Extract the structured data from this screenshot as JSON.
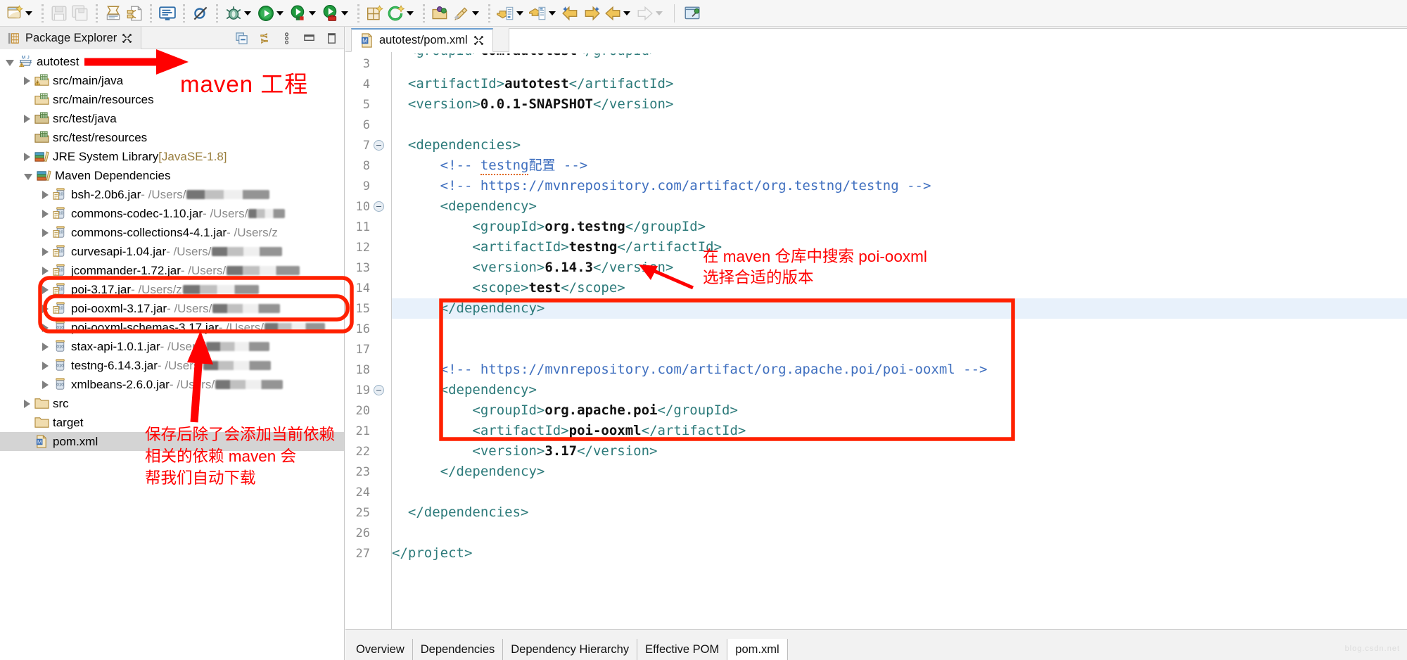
{
  "toolbar": {
    "items": [
      {
        "name": "new-wizard-icon",
        "caret": true
      },
      {
        "name": "save-icon",
        "caret": false
      },
      {
        "name": "save-all-icon",
        "caret": false
      },
      {
        "name": "print-icon",
        "caret": false
      },
      {
        "name": "refresh-link-icon",
        "caret": false
      },
      {
        "name": "open-console-icon",
        "caret": false
      },
      {
        "name": "skip-breakpoints-icon",
        "caret": false
      },
      {
        "name": "debug-icon",
        "caret": true
      },
      {
        "name": "run-icon",
        "caret": true
      },
      {
        "name": "coverage-icon",
        "caret": true
      },
      {
        "name": "external-tools-icon",
        "caret": true
      },
      {
        "name": "new-java-project-icon",
        "caret": false
      },
      {
        "name": "new-package-icon",
        "caret": true
      },
      {
        "name": "open-type-icon",
        "caret": false
      },
      {
        "name": "new-annotation-icon",
        "caret": true
      },
      {
        "name": "previous-annotation-icon",
        "caret": true
      },
      {
        "name": "next-annotation-icon",
        "caret": true
      },
      {
        "name": "last-edit-location-icon",
        "caret": false
      },
      {
        "name": "next-edit-location-icon",
        "caret": false
      },
      {
        "name": "back-icon",
        "caret": true
      },
      {
        "name": "forward-icon",
        "caret": true,
        "dim": true
      },
      {
        "name": "pin-editor-icon",
        "caret": false
      }
    ]
  },
  "package_explorer": {
    "tab_label": "Package Explorer",
    "view_tools": [
      "collapse-all-icon",
      "link-with-editor-icon",
      "view-menu-icon",
      "minimize-icon",
      "maximize-icon"
    ],
    "tree": [
      {
        "indent": 0,
        "arrow": "down",
        "icon": "maven-project-icon",
        "label": "autotest",
        "suffix": "",
        "name": "tree-item-autotest"
      },
      {
        "indent": 1,
        "arrow": "right",
        "icon": "source-folder-warning-icon",
        "label": "src/main/java",
        "suffix": "",
        "name": "tree-item-src-main-java"
      },
      {
        "indent": 1,
        "arrow": "none",
        "icon": "source-folder-icon",
        "label": "src/main/resources",
        "suffix": "",
        "name": "tree-item-src-main-resources"
      },
      {
        "indent": 1,
        "arrow": "right",
        "icon": "source-folder-green-icon",
        "label": "src/test/java",
        "suffix": "",
        "name": "tree-item-src-test-java"
      },
      {
        "indent": 1,
        "arrow": "none",
        "icon": "source-folder-green-icon",
        "label": "src/test/resources",
        "suffix": "",
        "name": "tree-item-src-test-resources"
      },
      {
        "indent": 1,
        "arrow": "right",
        "icon": "library-icon",
        "label": "JRE System Library",
        "suffix": " [JavaSE-1.8]",
        "suffix_class": "jre",
        "name": "tree-item-jre-system-library"
      },
      {
        "indent": 1,
        "arrow": "down",
        "icon": "library-icon",
        "label": "Maven Dependencies",
        "suffix": "",
        "name": "tree-item-maven-dependencies"
      },
      {
        "indent": 2,
        "arrow": "right",
        "icon": "jar-icon",
        "label": "bsh-2.0b6.jar",
        "suffix": " - /Users/",
        "blur": 118,
        "name": "tree-item-jar-bsh"
      },
      {
        "indent": 2,
        "arrow": "right",
        "icon": "jar-icon",
        "label": "commons-codec-1.10.jar",
        "suffix": " - /Users/",
        "blur": 52,
        "name": "tree-item-jar-commons-codec"
      },
      {
        "indent": 2,
        "arrow": "right",
        "icon": "jar-icon",
        "label": "commons-collections4-4.1.jar",
        "suffix": " - /Users/z",
        "blur": 0,
        "name": "tree-item-jar-commons-collections4"
      },
      {
        "indent": 2,
        "arrow": "right",
        "icon": "jar-icon",
        "label": "curvesapi-1.04.jar",
        "suffix": " - /Users/",
        "blur": 100,
        "name": "tree-item-jar-curvesapi"
      },
      {
        "indent": 2,
        "arrow": "right",
        "icon": "jar-icon",
        "label": "jcommander-1.72.jar",
        "suffix": " - /Users/",
        "blur": 104,
        "name": "tree-item-jar-jcommander"
      },
      {
        "indent": 2,
        "arrow": "right",
        "icon": "jar-icon",
        "label": "poi-3.17.jar",
        "suffix": " - /Users/z",
        "blur": 108,
        "name": "tree-item-jar-poi"
      },
      {
        "indent": 2,
        "arrow": "right",
        "icon": "jar-icon",
        "label": "poi-ooxml-3.17.jar",
        "suffix": " - /Users/",
        "blur": 96,
        "name": "tree-item-jar-poi-ooxml"
      },
      {
        "indent": 2,
        "arrow": "right",
        "icon": "jar-plain-icon",
        "label": "poi-ooxml-schemas-3.17.jar",
        "suffix": " - /Users/",
        "blur": 86,
        "name": "tree-item-jar-poi-ooxml-schemas"
      },
      {
        "indent": 2,
        "arrow": "right",
        "icon": "jar-plain-icon",
        "label": "stax-api-1.0.1.jar",
        "suffix": " - /Users/",
        "blur": 90,
        "name": "tree-item-jar-stax-api"
      },
      {
        "indent": 2,
        "arrow": "right",
        "icon": "jar-plain-icon",
        "label": "testng-6.14.3.jar",
        "suffix": " - /Users/",
        "blur": 96,
        "name": "tree-item-jar-testng"
      },
      {
        "indent": 2,
        "arrow": "right",
        "icon": "jar-plain-icon",
        "label": "xmlbeans-2.6.0.jar",
        "suffix": " - /Users/",
        "blur": 96,
        "name": "tree-item-jar-xmlbeans"
      },
      {
        "indent": 1,
        "arrow": "right",
        "icon": "folder-icon",
        "label": "src",
        "suffix": "",
        "name": "tree-item-src"
      },
      {
        "indent": 1,
        "arrow": "none",
        "icon": "folder-icon",
        "label": "target",
        "suffix": "",
        "name": "tree-item-target"
      },
      {
        "indent": 1,
        "arrow": "none",
        "icon": "pom-file-icon",
        "label": "pom.xml",
        "suffix": "",
        "selected": true,
        "name": "tree-item-pom-xml"
      }
    ]
  },
  "editor": {
    "tab_label": "autotest/pom.xml",
    "tab_icon": "maven-pom-icon",
    "bottom_tabs": [
      {
        "label": "Overview",
        "active": false
      },
      {
        "label": "Dependencies",
        "active": false
      },
      {
        "label": "Dependency Hierarchy",
        "active": false
      },
      {
        "label": "Effective POM",
        "active": false
      },
      {
        "label": "pom.xml",
        "active": true
      }
    ],
    "watermark": "blog.csdn.net",
    "lines": [
      {
        "n": "3",
        "fold": false,
        "clipped": true,
        "segments": [
          {
            "t": "  <groupId>",
            "c": "t-tag"
          },
          {
            "t": "com.autotest",
            "c": "t-val"
          },
          {
            "t": "</groupId>",
            "c": "t-tag"
          }
        ]
      },
      {
        "n": "4",
        "fold": false,
        "segments": [
          {
            "t": "  <artifactId>",
            "c": "t-tag"
          },
          {
            "t": "autotest",
            "c": "t-val"
          },
          {
            "t": "</artifactId>",
            "c": "t-tag"
          }
        ]
      },
      {
        "n": "5",
        "fold": false,
        "segments": [
          {
            "t": "  <version>",
            "c": "t-tag"
          },
          {
            "t": "0.0.1-SNAPSHOT",
            "c": "t-val"
          },
          {
            "t": "</version>",
            "c": "t-tag"
          }
        ]
      },
      {
        "n": "6",
        "fold": false,
        "segments": []
      },
      {
        "n": "7",
        "fold": true,
        "segments": [
          {
            "t": "  <dependencies>",
            "c": "t-tag"
          }
        ]
      },
      {
        "n": "8",
        "fold": false,
        "segments": [
          {
            "t": "      <!-- ",
            "c": "t-cmt"
          },
          {
            "t": "testng",
            "c": "t-cmt spell"
          },
          {
            "t": "配置 -->",
            "c": "t-cmt"
          }
        ]
      },
      {
        "n": "9",
        "fold": false,
        "segments": [
          {
            "t": "      <!-- https://mvnrepository.com/artifact/org.testng/testng -->",
            "c": "t-cmt"
          }
        ]
      },
      {
        "n": "10",
        "fold": true,
        "segments": [
          {
            "t": "      <dependency>",
            "c": "t-tag"
          }
        ]
      },
      {
        "n": "11",
        "fold": false,
        "segments": [
          {
            "t": "          <groupId>",
            "c": "t-tag"
          },
          {
            "t": "org.testng",
            "c": "t-val"
          },
          {
            "t": "</groupId>",
            "c": "t-tag"
          }
        ]
      },
      {
        "n": "12",
        "fold": false,
        "segments": [
          {
            "t": "          <artifactId>",
            "c": "t-tag"
          },
          {
            "t": "testng",
            "c": "t-val"
          },
          {
            "t": "</artifactId>",
            "c": "t-tag"
          }
        ]
      },
      {
        "n": "13",
        "fold": false,
        "segments": [
          {
            "t": "          <version>",
            "c": "t-tag"
          },
          {
            "t": "6.14.3",
            "c": "t-val"
          },
          {
            "t": "</version>",
            "c": "t-tag"
          }
        ]
      },
      {
        "n": "14",
        "fold": false,
        "segments": [
          {
            "t": "          <scope>",
            "c": "t-tag"
          },
          {
            "t": "test",
            "c": "t-val"
          },
          {
            "t": "</scope>",
            "c": "t-tag"
          }
        ]
      },
      {
        "n": "15",
        "fold": false,
        "hl": true,
        "segments": [
          {
            "t": "      </dependency>",
            "c": "t-tag"
          }
        ]
      },
      {
        "n": "16",
        "fold": false,
        "segments": []
      },
      {
        "n": "17",
        "fold": false,
        "segments": []
      },
      {
        "n": "18",
        "fold": false,
        "segments": [
          {
            "t": "      <!-- https://mvnrepository.com/artifact/org.apache.poi/poi-ooxml -->",
            "c": "t-cmt"
          }
        ]
      },
      {
        "n": "19",
        "fold": true,
        "segments": [
          {
            "t": "      <dependency>",
            "c": "t-tag"
          }
        ]
      },
      {
        "n": "20",
        "fold": false,
        "segments": [
          {
            "t": "          <groupId>",
            "c": "t-tag"
          },
          {
            "t": "org.apache.poi",
            "c": "t-val"
          },
          {
            "t": "</groupId>",
            "c": "t-tag"
          }
        ]
      },
      {
        "n": "21",
        "fold": false,
        "segments": [
          {
            "t": "          <artifactId>",
            "c": "t-tag"
          },
          {
            "t": "poi-ooxml",
            "c": "t-val"
          },
          {
            "t": "</artifactId>",
            "c": "t-tag"
          }
        ]
      },
      {
        "n": "22",
        "fold": false,
        "segments": [
          {
            "t": "          <version>",
            "c": "t-tag"
          },
          {
            "t": "3.17",
            "c": "t-val"
          },
          {
            "t": "</version>",
            "c": "t-tag"
          }
        ]
      },
      {
        "n": "23",
        "fold": false,
        "segments": [
          {
            "t": "      </dependency>",
            "c": "t-tag"
          }
        ]
      },
      {
        "n": "24",
        "fold": false,
        "segments": []
      },
      {
        "n": "25",
        "fold": false,
        "segments": [
          {
            "t": "  </dependencies>",
            "c": "t-tag"
          }
        ]
      },
      {
        "n": "26",
        "fold": false,
        "segments": []
      },
      {
        "n": "27",
        "fold": false,
        "segments": [
          {
            "t": "</project>",
            "c": "t-tag"
          }
        ]
      }
    ]
  },
  "annotations": {
    "accent_color": "#ff0000",
    "maven_project": "maven 工程",
    "search_repo_line1": "在 maven 仓库中搜索 poi-ooxml",
    "search_repo_line2": "选择合适的版本",
    "save_line1": "保存后除了会添加当前依赖",
    "save_line2": "相关的依赖 maven 会",
    "save_line3": "帮我们自动下载"
  }
}
